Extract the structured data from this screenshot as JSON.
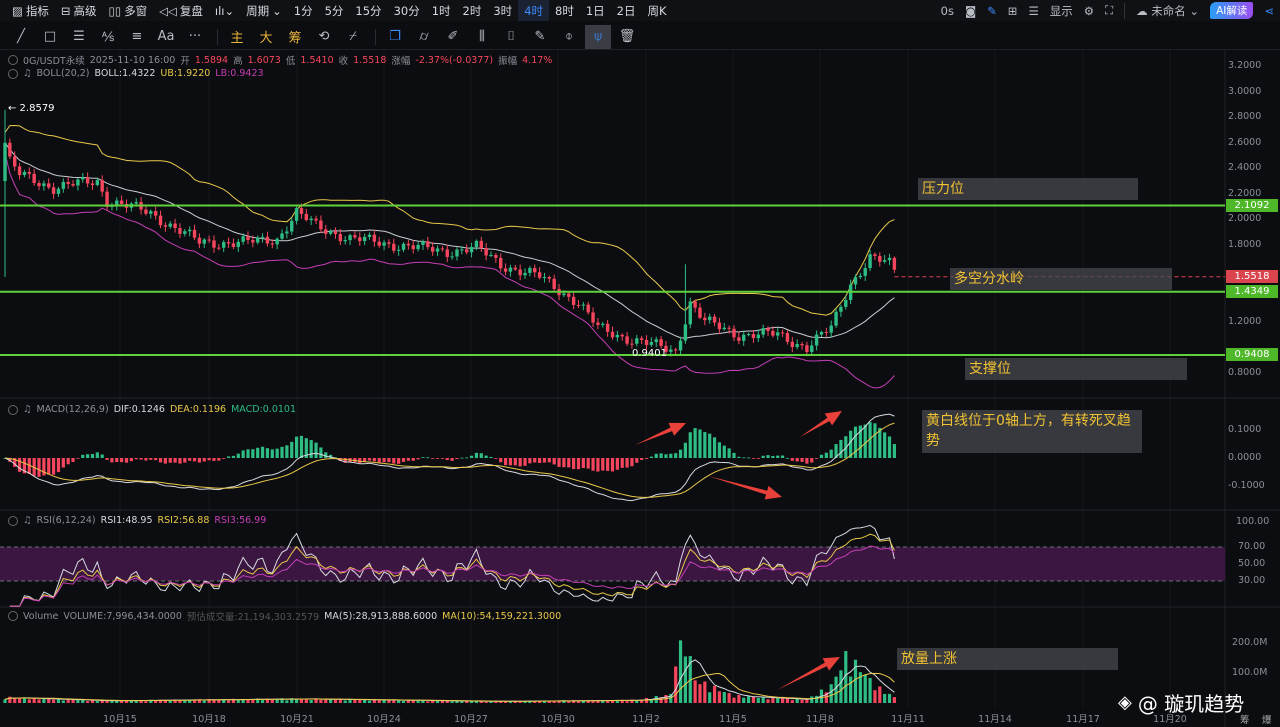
{
  "toolbar": {
    "items": [
      "指标",
      "高级",
      "多窗",
      "复盘",
      "周期",
      "1分",
      "5分",
      "15分",
      "30分",
      "1时",
      "2时",
      "3时",
      "4时",
      "8时",
      "1日",
      "2日",
      "周K"
    ],
    "active": "4时",
    "right": {
      "countdown": "0s",
      "display": "显示",
      "layout_name": "未命名",
      "ai": "AI解读"
    }
  },
  "drawing_toolbar": {
    "text_tool": "Aa",
    "more": "···",
    "main": "主",
    "big": "大",
    "chips": "筹"
  },
  "symbol_info": {
    "symbol": "0G/USDT永续",
    "datetime": "2025-11-10 16:00",
    "open_label": "开",
    "open": "1.5894",
    "high_label": "高",
    "high": "1.6073",
    "low_label": "低",
    "low": "1.5410",
    "close_label": "收",
    "close": "1.5518",
    "change_label": "涨幅",
    "change": "-2.37%(-0.0377)",
    "amp_label": "振幅",
    "amp": "4.17%"
  },
  "boll": {
    "name": "BOLL(20,2)",
    "mid": "BOLL:1.4322",
    "ub": "UB:1.9220",
    "lb": "LB:0.9423"
  },
  "macd": {
    "name": "MACD(12,26,9)",
    "dif": "DIF:0.1246",
    "dea": "DEA:0.1196",
    "macd": "MACD:0.0101"
  },
  "rsi": {
    "name": "RSI(6,12,24)",
    "rsi1": "RSI1:48.95",
    "rsi2": "RSI2:56.88",
    "rsi3": "RSI3:56.99"
  },
  "volume": {
    "name": "Volume",
    "vol": "VOLUME:7,996,434.0000",
    "est": "预估成交量:21,194,303.2579",
    "ma5": "MA(5):28,913,888.6000",
    "ma10": "MA(10):54,159,221.3000"
  },
  "price_axis": [
    "3.2000",
    "3.0000",
    "2.8000",
    "2.6000",
    "2.4000",
    "2.2000",
    "2.0000",
    "1.8000",
    "1.2000",
    "0.8000"
  ],
  "macd_axis": [
    "0.1000",
    "0.0000",
    "-0.1000"
  ],
  "rsi_axis": [
    "100.00",
    "70.00",
    "50.00",
    "30.00"
  ],
  "vol_axis": [
    "200.0M",
    "100.0M"
  ],
  "x_axis": [
    "10月15",
    "10月18",
    "10月21",
    "10月24",
    "10月27",
    "10月30",
    "11月2",
    "11月5",
    "11月8",
    "11月11",
    "11月14",
    "11月17",
    "11月20"
  ],
  "price_tags": {
    "resistance": "2.1092",
    "last": "1.5518",
    "pivot": "1.4349",
    "support": "0.9408"
  },
  "markers": {
    "high": "← 2.8579",
    "low": "0.9401"
  },
  "annotations": {
    "resistance": "压力位",
    "pivot": "多空分水岭",
    "support": "支撑位",
    "macd_note": "黄白线位于0轴上方，有转死叉趋势",
    "volume_note": "放量上涨"
  },
  "watermark": "@ 璇玑趋势",
  "bottom_right": [
    "筹",
    "爆"
  ],
  "colors": {
    "up": "#2ebd85",
    "down": "#f6465d",
    "line": "#5fd13a",
    "boll_mid": "#c9ccd2",
    "boll_ub": "#e9c94a",
    "boll_lb": "#c43fb6"
  },
  "chart_data": {
    "type": "candlestick",
    "candles": 184,
    "key_closes": [
      [
        0,
        2.6
      ],
      [
        1,
        2.45
      ],
      [
        3,
        2.35
      ],
      [
        10,
        2.25
      ],
      [
        19,
        2.3
      ],
      [
        21,
        2.15
      ],
      [
        30,
        2.05
      ],
      [
        40,
        1.82
      ],
      [
        50,
        1.82
      ],
      [
        56,
        1.85
      ],
      [
        60,
        2.05
      ],
      [
        64,
        1.95
      ],
      [
        71,
        1.85
      ],
      [
        81,
        1.8
      ],
      [
        91,
        1.75
      ],
      [
        97,
        1.78
      ],
      [
        102,
        1.65
      ],
      [
        110,
        1.55
      ],
      [
        118,
        1.35
      ],
      [
        122,
        1.15
      ],
      [
        130,
        1.05
      ],
      [
        138,
        0.97
      ],
      [
        141,
        1.35
      ],
      [
        144,
        1.2
      ],
      [
        151,
        1.1
      ],
      [
        159,
        1.1
      ],
      [
        165,
        1.0
      ],
      [
        170,
        1.15
      ],
      [
        174,
        1.5
      ],
      [
        178,
        1.7
      ],
      [
        182,
        1.65
      ],
      [
        184,
        1.55
      ]
    ],
    "key_volumes_m": [
      [
        0,
        20
      ],
      [
        20,
        8
      ],
      [
        60,
        15
      ],
      [
        100,
        6
      ],
      [
        130,
        10
      ],
      [
        137,
        30
      ],
      [
        138,
        160
      ],
      [
        140,
        220
      ],
      [
        142,
        80
      ],
      [
        150,
        25
      ],
      [
        165,
        12
      ],
      [
        170,
        60
      ],
      [
        173,
        160
      ],
      [
        176,
        120
      ],
      [
        179,
        60
      ],
      [
        184,
        10
      ]
    ],
    "levels": {
      "resistance": 2.1092,
      "pivot": 1.4349,
      "support": 0.9408,
      "last": 1.5518
    }
  }
}
